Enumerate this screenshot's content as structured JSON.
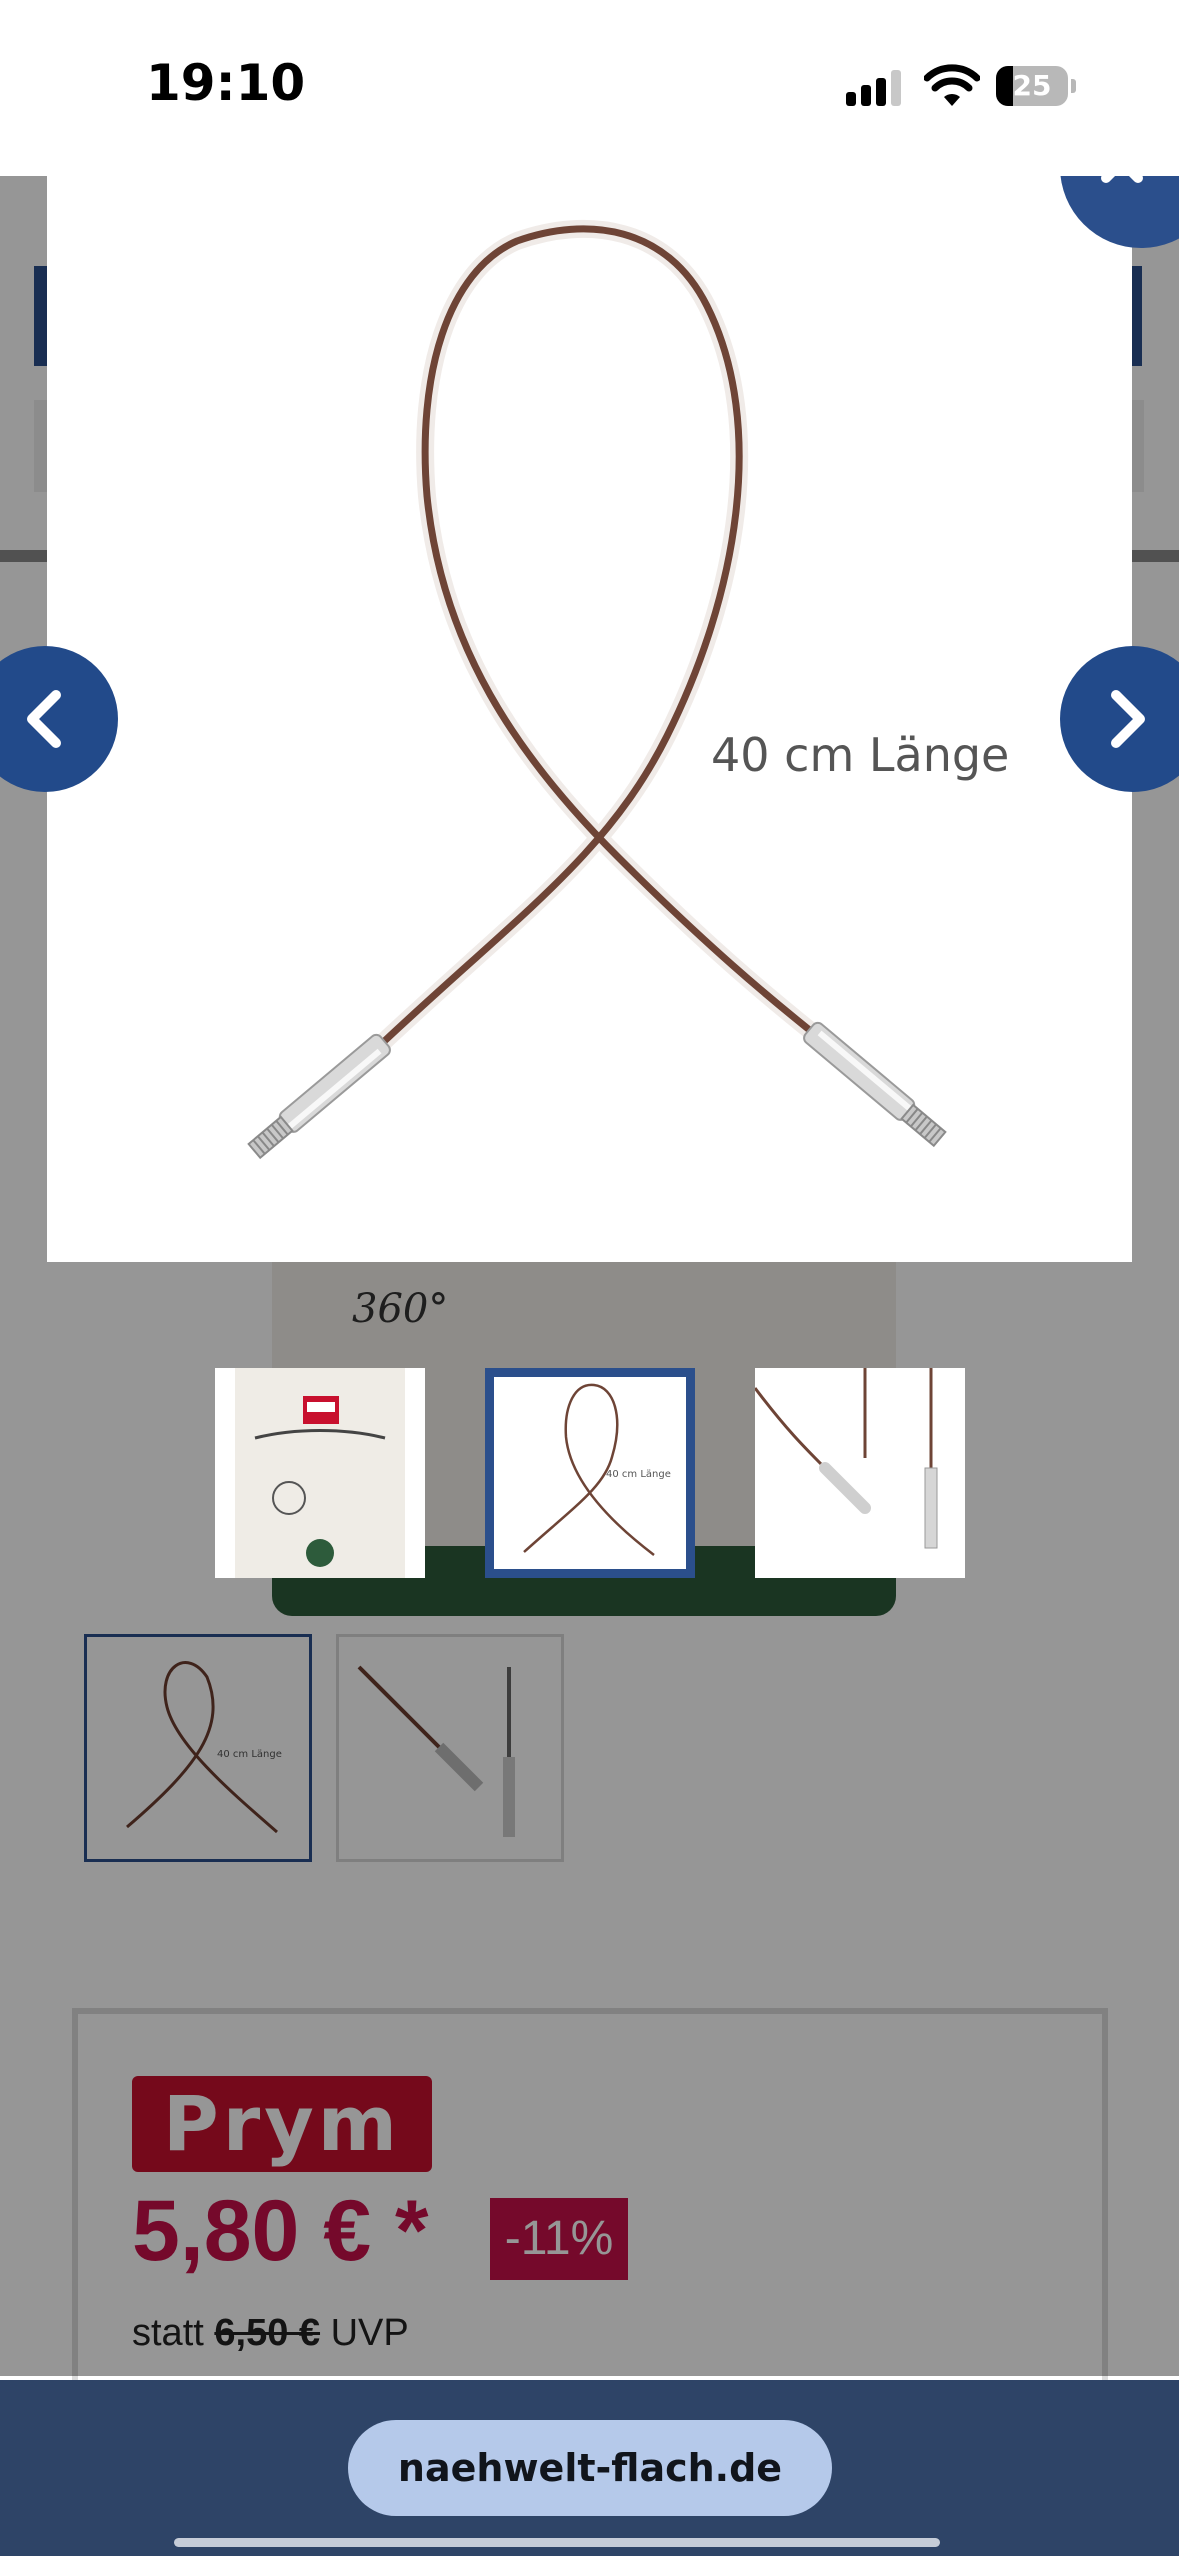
{
  "status_bar": {
    "time": "19:10",
    "battery_level": "25",
    "icons": [
      "signal-icon",
      "wifi-icon",
      "battery-icon"
    ]
  },
  "lightbox": {
    "image_label": "40 cm Länge",
    "thumbnails": [
      {
        "name": "packaging",
        "active": false
      },
      {
        "name": "cable-loop",
        "active": true
      },
      {
        "name": "cable-detail",
        "active": false
      }
    ],
    "controls": {
      "close": "close-icon",
      "prev": "chevron-left-icon",
      "next": "chevron-right-icon"
    },
    "accent_color": "#2b4f8c"
  },
  "page": {
    "brand": "Prym",
    "price": "5,80 € *",
    "discount": "-11%",
    "strike_prefix": "statt",
    "old_price": "6,50 €",
    "strike_suffix": "UVP",
    "price_color": "#c8104a",
    "sketch_text": "360°"
  },
  "browser": {
    "url": "naehwelt-flach.de"
  }
}
